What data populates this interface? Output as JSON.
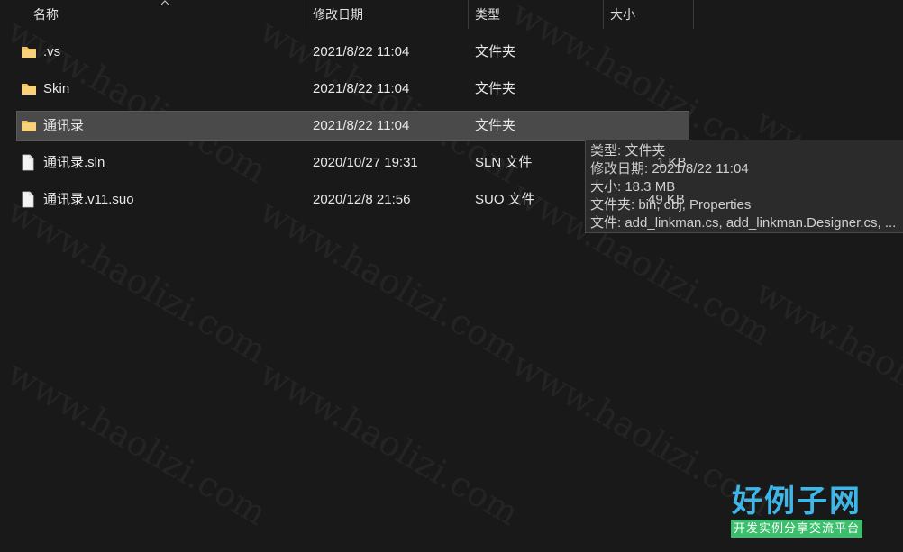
{
  "columns": {
    "name": "名称",
    "date": "修改日期",
    "type": "类型",
    "size": "大小"
  },
  "rows": [
    {
      "name": ".vs",
      "date": "2021/8/22 11:04",
      "type": "文件夹",
      "icon": "folder-icon",
      "selected": false
    },
    {
      "name": "Skin",
      "date": "2021/8/22 11:04",
      "type": "文件夹",
      "icon": "folder-icon",
      "selected": false
    },
    {
      "name": "通讯录",
      "date": "2021/8/22 11:04",
      "type": "文件夹",
      "icon": "folder-icon",
      "selected": true
    },
    {
      "name": "通讯录.sln",
      "date": "2020/10/27 19:31",
      "type": "SLN 文件",
      "size": "1 KB",
      "icon": "file-icon",
      "selected": false
    },
    {
      "name": "通讯录.v11.suo",
      "date": "2020/12/8 21:56",
      "type": "SUO 文件",
      "size": "49 KB",
      "icon": "file-icon",
      "selected": false
    }
  ],
  "tooltip": {
    "lines": [
      "类型: 文件夹",
      "修改日期: 2021/8/22 11:04",
      "大小: 18.3 MB",
      "文件夹: bin, obj, Properties",
      "文件: add_linkman.cs, add_linkman.Designer.cs, ..."
    ]
  },
  "watermark": {
    "text": "www.haolizi.com",
    "brand_title": "好例子网",
    "brand_subtitle": "开发实例分享交流平台"
  },
  "colors": {
    "background": "#191919",
    "selected_row": "#4a4a4a",
    "folder": "#f2c55c",
    "brand_blue": "#3fb6e8",
    "brand_green": "#3bbf6c"
  }
}
